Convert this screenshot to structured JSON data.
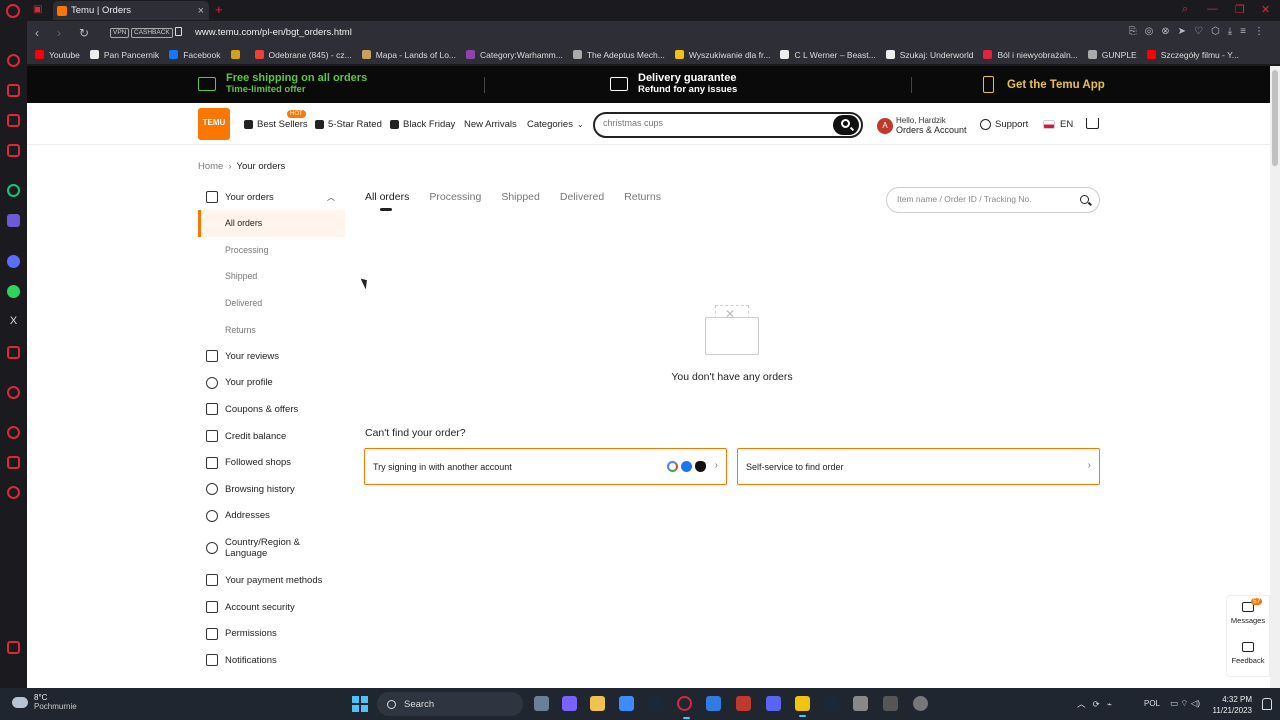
{
  "browser": {
    "tab_title": "Temu | Orders",
    "url": "www.temu.com/pl-en/bgt_orders.html",
    "vpn_label": "VPN",
    "cashback_label": "CASHBACK",
    "bookmarks": [
      {
        "label": "Youtube",
        "color": "#ff0000"
      },
      {
        "label": "Pan Pancernik",
        "color": "#eeeeee"
      },
      {
        "label": "Facebook",
        "color": "#1877f2"
      },
      {
        "label": "",
        "color": "#d4a017"
      },
      {
        "label": "Odebrane (845) - cz...",
        "color": "#ea4335"
      },
      {
        "label": "Mapa - Lands of Lo...",
        "color": "#c8a060"
      },
      {
        "label": "Category:Warhamm...",
        "color": "#8e44ad"
      },
      {
        "label": "The Adeptus Mech...",
        "color": "#aaaaaa"
      },
      {
        "label": "Wyszukiwanie dla fr...",
        "color": "#f1c40f"
      },
      {
        "label": "C L Werner – Beast...",
        "color": "#eeeeee"
      },
      {
        "label": "Szukaj: Underworld",
        "color": "#eeeeee"
      },
      {
        "label": "Ból i niewyobrażaln...",
        "color": "#e0243b"
      },
      {
        "label": "GUNPLE",
        "color": "#aaaaaa"
      },
      {
        "label": "Szczegóły filmu - Y...",
        "color": "#ff0000"
      }
    ]
  },
  "promo": {
    "shipping_title": "Free shipping on all orders",
    "shipping_sub": "Time-limited offer",
    "delivery_title": "Delivery guarantee",
    "delivery_sub": "Refund for any issues",
    "app_label": "Get the Temu App"
  },
  "header": {
    "logo_text": "TEMU",
    "hot_badge": "HOT",
    "nav": [
      "Best Sellers",
      "5-Star Rated",
      "Black Friday",
      "New Arrivals",
      "Categories"
    ],
    "search_placeholder": "christmas cups",
    "avatar_letter": "A",
    "greeting": "Hello, Hardzik",
    "account_label": "Orders & Account",
    "support_label": "Support",
    "language": "EN"
  },
  "breadcrumb": {
    "home": "Home",
    "current": "Your orders"
  },
  "sidebar": {
    "orders_label": "Your orders",
    "order_subitems": [
      "All orders",
      "Processing",
      "Shipped",
      "Delivered",
      "Returns"
    ],
    "items": [
      {
        "label": "Your reviews",
        "icon": "reviews-icon"
      },
      {
        "label": "Your profile",
        "icon": "profile-icon"
      },
      {
        "label": "Coupons & offers",
        "icon": "coupon-icon"
      },
      {
        "label": "Credit balance",
        "icon": "credit-icon"
      },
      {
        "label": "Followed shops",
        "icon": "shop-icon"
      },
      {
        "label": "Browsing history",
        "icon": "history-icon"
      },
      {
        "label": "Addresses",
        "icon": "location-icon"
      },
      {
        "label": "Country/Region & Language",
        "icon": "globe-icon"
      },
      {
        "label": "Your payment methods",
        "icon": "card-icon"
      },
      {
        "label": "Account security",
        "icon": "shield-icon"
      },
      {
        "label": "Permissions",
        "icon": "permissions-icon"
      },
      {
        "label": "Notifications",
        "icon": "bell-icon"
      }
    ]
  },
  "orders": {
    "tabs": [
      "All orders",
      "Processing",
      "Shipped",
      "Delivered",
      "Returns"
    ],
    "active_tab": "All orders",
    "search_placeholder": "Item name / Order ID / Tracking No.",
    "empty_message": "You don't have any orders",
    "cant_find_title": "Can't find your order?",
    "option_signin": "Try signing in with another account",
    "option_selfservice": "Self-service to find order"
  },
  "floating": {
    "messages_label": "Messages",
    "messages_count": "57",
    "feedback_label": "Feedback"
  },
  "taskbar": {
    "temperature": "8°C",
    "weather_desc": "Pochmurnie",
    "search_label": "Search",
    "language": "POL",
    "time": "4:32 PM",
    "date": "11/21/2023"
  },
  "colors": {
    "accent": "#fb7701",
    "promo_green": "#5ec445",
    "promo_gold": "#e8c14a"
  }
}
